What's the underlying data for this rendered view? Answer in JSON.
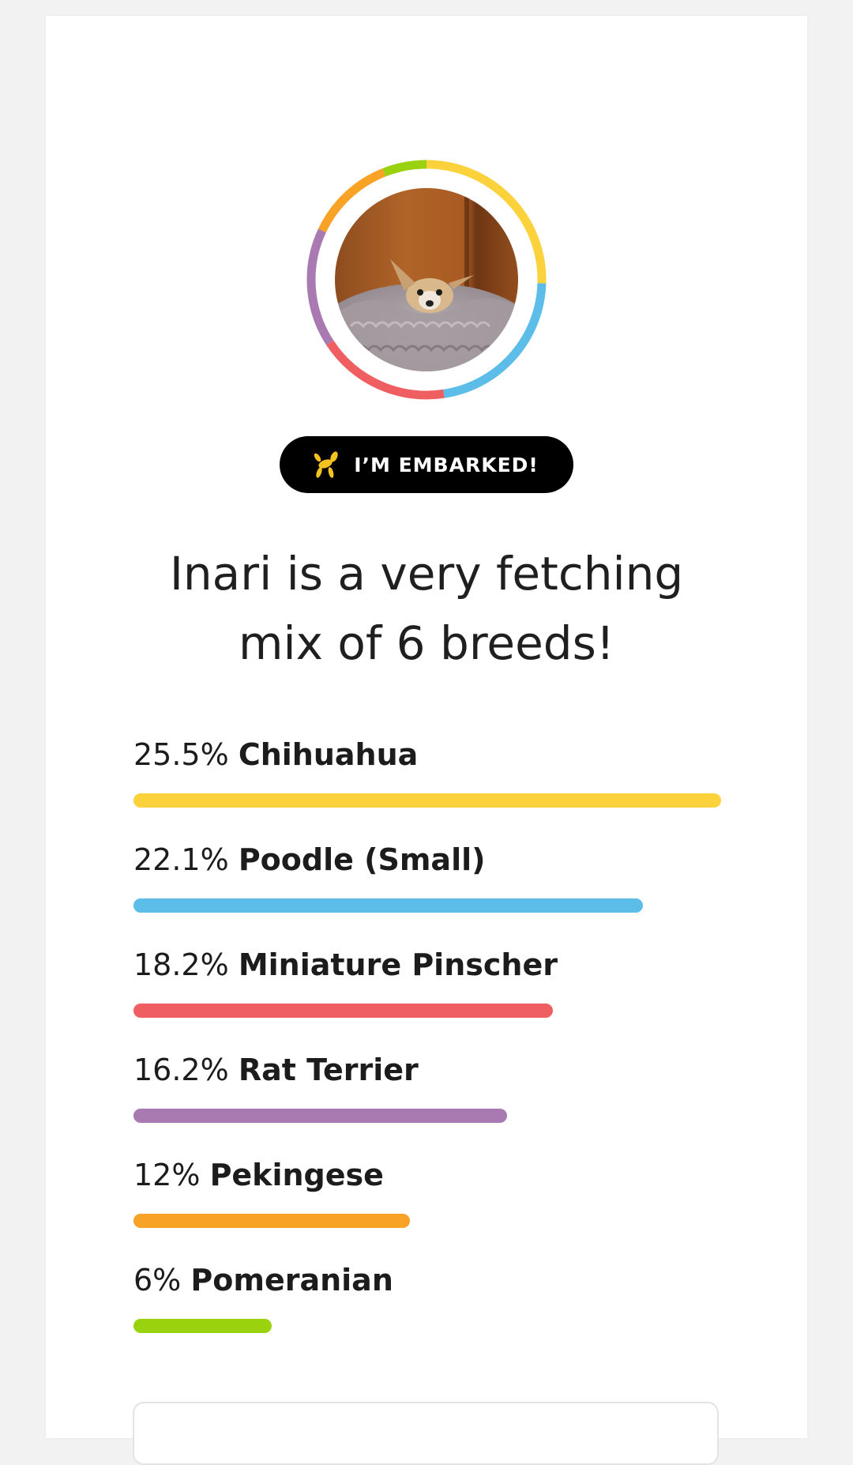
{
  "dog": {
    "name": "Inari"
  },
  "badge": {
    "label": "I’M EMBARKED!",
    "icon": "balloon-dog-icon",
    "icon_color": "#f5c320"
  },
  "headline": {
    "line1": "Inari is a very fetching",
    "line2": "mix of 6 breeds!"
  },
  "breeds": [
    {
      "percent_label": "25.5%",
      "name": "Chihuahua",
      "percent": 25.5,
      "color": "#fcd23c"
    },
    {
      "percent_label": "22.1%",
      "name": "Poodle (Small)",
      "percent": 22.1,
      "color": "#5bbde8"
    },
    {
      "percent_label": "18.2%",
      "name": "Miniature Pinscher",
      "percent": 18.2,
      "color": "#ef5f61"
    },
    {
      "percent_label": "16.2%",
      "name": "Rat Terrier",
      "percent": 16.2,
      "color": "#a87ab1"
    },
    {
      "percent_label": "12%",
      "name": "Pekingese",
      "percent": 12,
      "color": "#f8a226"
    },
    {
      "percent_label": "6%",
      "name": "Pomeranian",
      "percent": 6,
      "color": "#9bd20f"
    }
  ],
  "chart_data": {
    "type": "bar",
    "categories": [
      "Chihuahua",
      "Poodle (Small)",
      "Miniature Pinscher",
      "Rat Terrier",
      "Pekingese",
      "Pomeranian"
    ],
    "values": [
      25.5,
      22.1,
      18.2,
      16.2,
      12,
      6
    ],
    "colors": [
      "#fcd23c",
      "#5bbde8",
      "#ef5f61",
      "#a87ab1",
      "#f8a226",
      "#9bd20f"
    ],
    "orientation": "horizontal"
  }
}
